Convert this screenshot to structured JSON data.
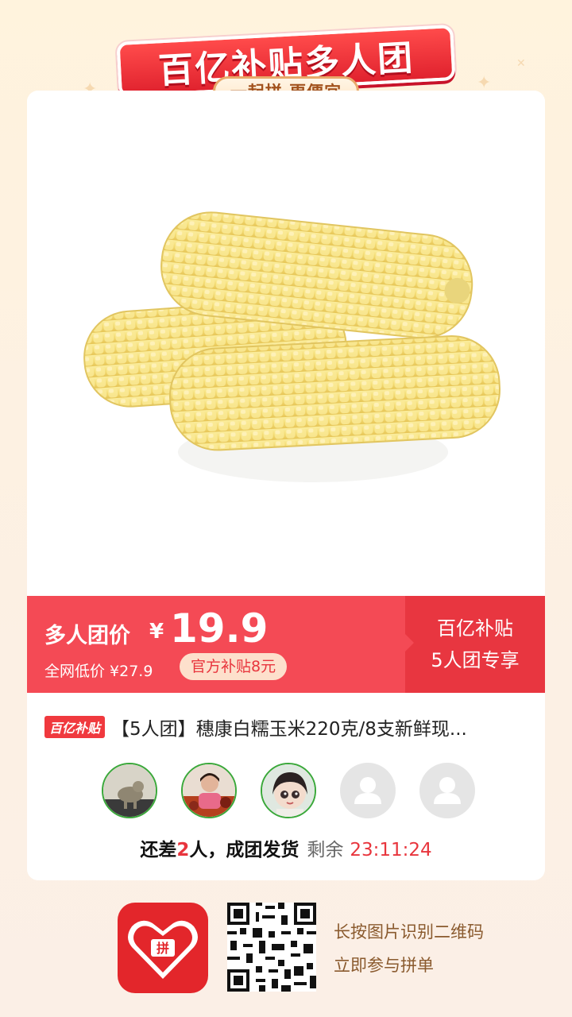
{
  "banner": {
    "title": "百亿补贴多人团",
    "subtitle": "一起拼 更便宜"
  },
  "product": {
    "image_alt": "corn-image",
    "price_label": "多人团价",
    "currency": "¥",
    "price": "19.9",
    "original_price": "全网低价 ¥27.9",
    "subsidy": "官方补贴8元",
    "promo_line1": "百亿补贴",
    "promo_line2": "5人团专享",
    "tag": "百亿补贴",
    "title": "【5人团】穗康白糯玉米220克/8支新鲜现..."
  },
  "group": {
    "avatars": [
      "avatar-1",
      "avatar-2",
      "avatar-3",
      "empty",
      "empty"
    ],
    "status_prefix": "还差",
    "status_num": "2",
    "status_suffix": "人，成团发货",
    "remaining_label": "剩余",
    "countdown": "23:11:24"
  },
  "footer": {
    "line1": "长按图片识别二维码",
    "line2": "立即参与拼单"
  },
  "colors": {
    "accent": "#f44a55",
    "accent_dark": "#e83640",
    "countdown": "#e8353d"
  }
}
